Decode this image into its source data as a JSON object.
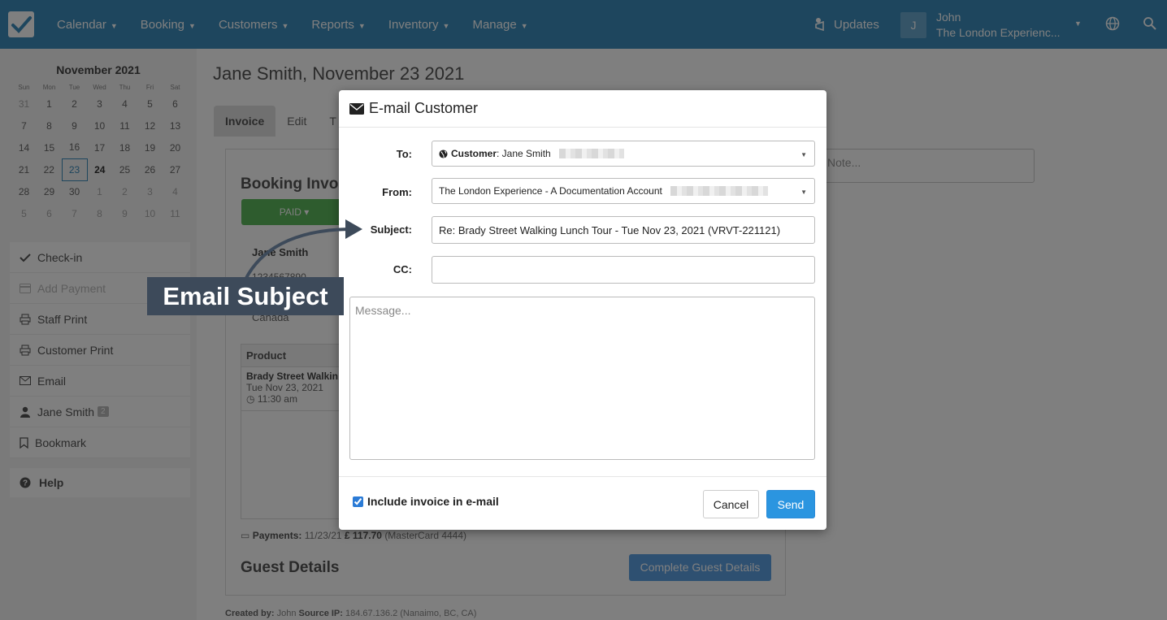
{
  "navbar": {
    "menu": [
      "Calendar",
      "Booking",
      "Customers",
      "Reports",
      "Inventory",
      "Manage"
    ],
    "updates": "Updates",
    "user_initial": "J",
    "user_name": "John",
    "user_company": "The London Experienc...",
    "colors": {
      "bar": "#3c8dbc"
    }
  },
  "sidebar": {
    "calendar": {
      "title": "November 2021",
      "weekdays": [
        "Sun",
        "Mon",
        "Tue",
        "Wed",
        "Thu",
        "Fri",
        "Sat"
      ],
      "weeks": [
        [
          "31",
          "1",
          "2",
          "3",
          "4",
          "5",
          "6"
        ],
        [
          "7",
          "8",
          "9",
          "10",
          "11",
          "12",
          "13"
        ],
        [
          "14",
          "15",
          "16",
          "17",
          "18",
          "19",
          "20"
        ],
        [
          "21",
          "22",
          "23",
          "24",
          "25",
          "26",
          "27"
        ],
        [
          "28",
          "29",
          "30",
          "1",
          "2",
          "3",
          "4"
        ],
        [
          "5",
          "6",
          "7",
          "8",
          "9",
          "10",
          "11"
        ]
      ],
      "selected": "23",
      "bold": "24"
    },
    "items": {
      "checkin": "Check-in",
      "add_payment": "Add Payment",
      "staff_print": "Staff Print",
      "customer_print": "Customer Print",
      "email": "Email",
      "customer": "Jane Smith",
      "customer_badge": "2",
      "bookmark": "Bookmark"
    },
    "help": "Help"
  },
  "main": {
    "title": "Jane Smith, November 23 2021",
    "tabs": {
      "invoice": "Invoice",
      "edit": "Edit",
      "other": "T"
    },
    "booking_heading": "Booking Invoi",
    "paid_label": "PAID",
    "customer_name": "Jane Smith",
    "customer_phone": "1234567890",
    "customer_country": "Canada",
    "product_header": "Product",
    "product_name": "Brady Street Walkin",
    "product_date": "Tue Nov 23, 2021",
    "product_time": "11:30 am",
    "payments_label": "Payments:",
    "payments_date": "11/23/21",
    "payments_amount": "£ 117.70",
    "payments_method": "(MasterCard 4444)",
    "guest_heading": "Guest Details",
    "complete_guest_button": "Complete Guest Details",
    "created_by_label": "Created by:",
    "created_by": "John",
    "source_ip_label": "Source IP:",
    "source_ip": "184.67.136.2 (Nanaimo, BC, CA)",
    "note_placeholder": "Note..."
  },
  "modal": {
    "title": "E-mail Customer",
    "to_label": "To:",
    "to_prefix": "Customer",
    "to_value": ": Jane Smith",
    "from_label": "From:",
    "from_value": "The London Experience - A Documentation Account",
    "subject_label": "Subject:",
    "subject_value": "Re: Brady Street Walking Lunch Tour - Tue Nov 23, 2021 (VRVT-221121)",
    "cc_label": "CC:",
    "cc_value": "",
    "message_placeholder": "Message...",
    "include_invoice_label": "Include invoice in e-mail",
    "include_invoice_checked": true,
    "cancel_label": "Cancel",
    "send_label": "Send",
    "colors": {
      "send": "#2b95e0"
    }
  },
  "annotation": {
    "text": "Email Subject",
    "colors": {
      "callout": "#3d4a5a"
    }
  }
}
